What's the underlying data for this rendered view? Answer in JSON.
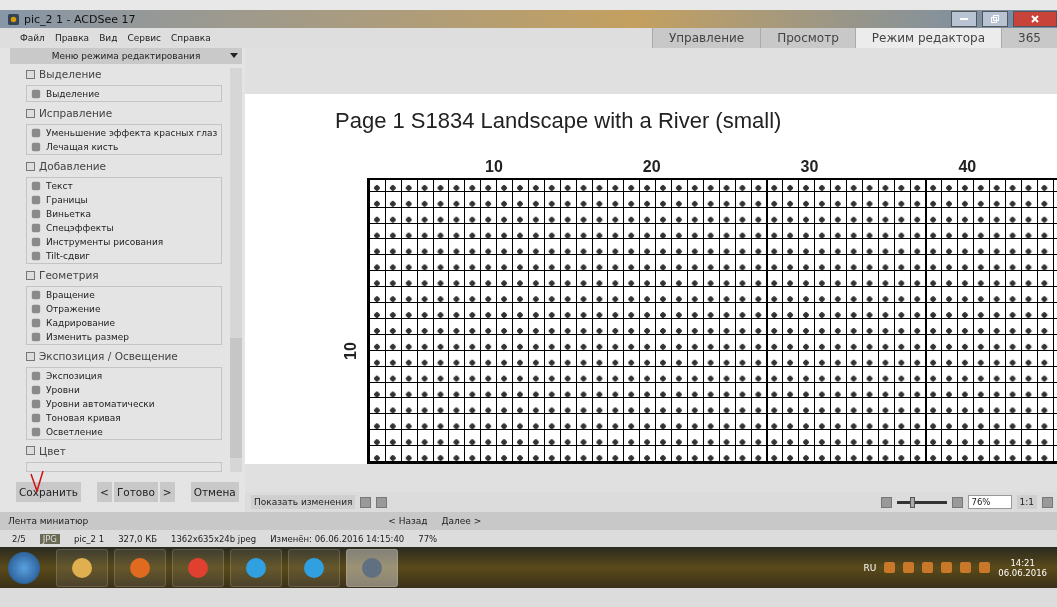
{
  "window": {
    "title": "pic_2 1 - ACDSee 17"
  },
  "menu": [
    "Файл",
    "Правка",
    "Вид",
    "Сервис",
    "Справка"
  ],
  "mode_tabs": [
    {
      "label": "Управление",
      "selected": false
    },
    {
      "label": "Просмотр",
      "selected": false
    },
    {
      "label": "Режим редактора",
      "selected": true
    },
    {
      "label": "365",
      "selected": false
    }
  ],
  "panel": {
    "header": "Меню режима редактирования",
    "groups": [
      {
        "title": "Выделение",
        "items": [
          "Выделение"
        ]
      },
      {
        "title": "Исправление",
        "items": [
          "Уменьшение эффекта красных глаз",
          "Лечащая кисть"
        ]
      },
      {
        "title": "Добавление",
        "items": [
          "Текст",
          "Границы",
          "Виньетка",
          "Спецэффекты",
          "Инструменты рисования",
          "Tilt-сдвиг"
        ]
      },
      {
        "title": "Геометрия",
        "items": [
          "Вращение",
          "Отражение",
          "Кадрирование",
          "Изменить размер"
        ]
      },
      {
        "title": "Экспозиция / Освещение",
        "items": [
          "Экспозиция",
          "Уровни",
          "Уровни автоматически",
          "Тоновая кривая",
          "Осветление"
        ]
      },
      {
        "title": "Цвет"
      }
    ]
  },
  "panel_buttons": {
    "save": "Сохранить",
    "prev": "<",
    "done": "Готово",
    "next": ">",
    "cancel": "Отмена"
  },
  "document": {
    "title": "Page 1  S1834 Landscape with a River (small)",
    "column_labels": [
      "10",
      "20",
      "30",
      "40"
    ],
    "row_label": "10"
  },
  "toolbar": {
    "show_changes": "Показать изменения",
    "zoom": {
      "level": 0.3
    },
    "zoom_value": "76%",
    "actual_size": "1:1"
  },
  "filmstrip": {
    "label": "Лента миниатюр",
    "back": "< Назад",
    "forward": "Далее >"
  },
  "status_bar": [
    "2/5",
    "JPG",
    "pic_2 1",
    "327,0 КБ",
    "1362x635x24b jpeg",
    "Изменён: 06.06.2016 14:15:40",
    "77%"
  ],
  "taskbar": {
    "apps": [
      {
        "selected": false
      },
      {
        "selected": false
      },
      {
        "selected": false
      },
      {
        "selected": false
      },
      {
        "selected": false
      },
      {
        "selected": true
      }
    ],
    "language": "RU",
    "time": "14:21",
    "date": "06.06.2016"
  }
}
